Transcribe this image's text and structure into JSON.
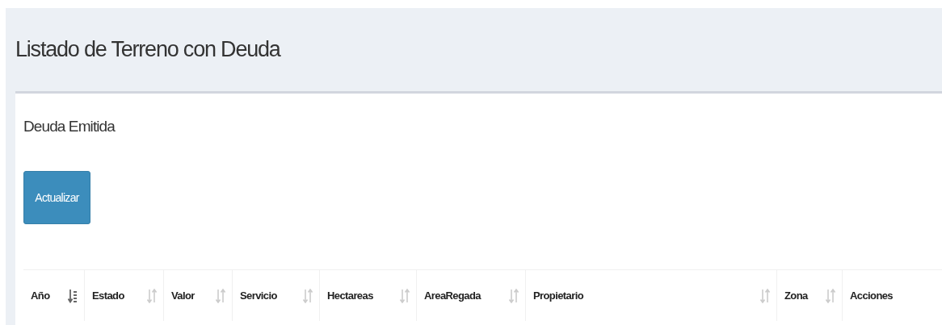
{
  "page_title": "Listado de Terreno con Deuda",
  "panel": {
    "title": "Deuda Emitida",
    "button": "Actualizar"
  },
  "table": {
    "columns": [
      {
        "label": "Año",
        "sortable": true,
        "sorted": true
      },
      {
        "label": "Estado",
        "sortable": true,
        "sorted": false
      },
      {
        "label": "Valor",
        "sortable": true,
        "sorted": false
      },
      {
        "label": "Servicio",
        "sortable": true,
        "sorted": false
      },
      {
        "label": "Hectareas",
        "sortable": true,
        "sorted": false
      },
      {
        "label": "AreaRegada",
        "sortable": true,
        "sorted": false
      },
      {
        "label": "Propietario",
        "sortable": true,
        "sorted": false
      },
      {
        "label": "Zona",
        "sortable": true,
        "sorted": false
      },
      {
        "label": "Acciones",
        "sortable": false
      }
    ]
  }
}
